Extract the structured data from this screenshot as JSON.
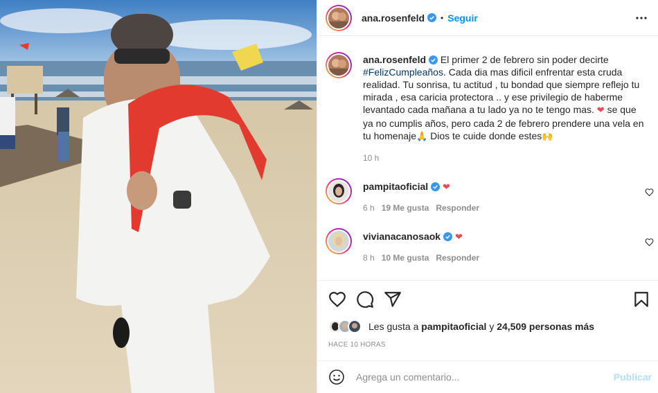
{
  "post": {
    "username": "ana.rosenfeld",
    "follow_label": "Seguir",
    "separator": "•"
  },
  "caption": {
    "username": "ana.rosenfeld",
    "text_1": "El primer 2 de febrero sin poder decirte",
    "hashtag": "#FelizCumpleaños",
    "text_2": ". Cada dia mas dificil enfrentar esta cruda realidad. Tu sonrisa, tu actitud , tu bondad que siempre reflejo tu mirada , esa caricia protectora .. y ese privilegio de haberme levantado cada mañana a tu lado ya no te tengo mas.",
    "heart": "❤",
    "text_3": "se que ya no cumplis años, pero cada 2 de febrero prendere una vela en tu homenaje",
    "pray": "🙏",
    "text_4": "Dios te cuide donde estes",
    "face": "🙌",
    "time": "10 h"
  },
  "comments": [
    {
      "username": "pampitaoficial",
      "text": "❤",
      "time": "6 h",
      "likes": "19 Me gusta",
      "reply": "Responder"
    },
    {
      "username": "vivianacanosaok",
      "text": "❤",
      "time": "8 h",
      "likes": "10 Me gusta",
      "reply": "Responder"
    }
  ],
  "likes": {
    "prefix": "Les gusta a",
    "user": "pampitaoficial",
    "middle": "y",
    "count": "24,509 personas más"
  },
  "timeago": "HACE 10 HORAS",
  "add_comment": {
    "placeholder": "Agrega un comentario...",
    "publish_label": "Publicar"
  },
  "colors": {
    "link_blue": "#0095f6",
    "publish_disabled": "#b2dffc",
    "heart_red": "#ed4956",
    "verified_blue": "#3897f0",
    "hashtag": "#00376b"
  },
  "icons": [
    "verified-icon",
    "more-options-icon",
    "heart-icon",
    "comment-icon",
    "share-icon",
    "bookmark-icon",
    "emoji-icon"
  ]
}
